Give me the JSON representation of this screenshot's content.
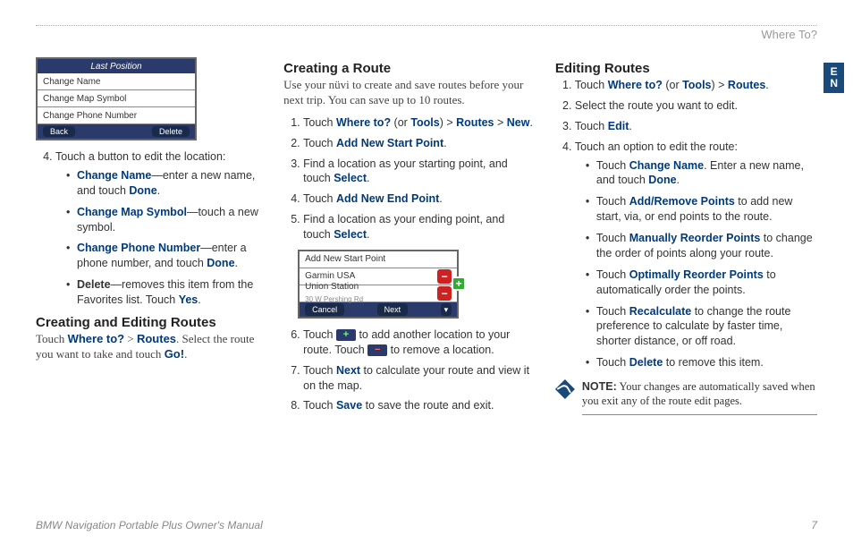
{
  "breadcrumb": "Where To?",
  "side_tab": [
    "E",
    "N"
  ],
  "footer": {
    "left": "BMW Navigation Portable Plus Owner's Manual",
    "page": "7"
  },
  "col1": {
    "device": {
      "title": "Last Position",
      "rows": [
        "Change Name",
        "Change Map Symbol",
        "Change Phone Number"
      ],
      "back": "Back",
      "delete": "Delete"
    },
    "ol_start": 4,
    "step4": "Touch a button to edit the location:",
    "bullets": [
      {
        "b": "Change Name",
        "t": "—enter a new name, and touch ",
        "b2": "Done",
        "t2": "."
      },
      {
        "b": "Change Map Symbol",
        "t": "—touch a new symbol."
      },
      {
        "b": "Change Phone Number",
        "t": "—enter a phone number, and touch ",
        "b2": "Done",
        "t2": "."
      },
      {
        "b_black": "Delete",
        "t": "—removes this item from the Favorites list. Touch ",
        "b2": "Yes",
        "t2": "."
      }
    ],
    "h2": "Creating and Editing Routes",
    "intro_pre": "Touch ",
    "intro_b1": "Where to?",
    "intro_mid": " > ",
    "intro_b2": "Routes",
    "intro_post": ". Select the route you want to take and touch ",
    "intro_b3": "Go!",
    "intro_end": "."
  },
  "col2": {
    "h2": "Creating a Route",
    "intro": "Use your nüvi to create and save routes before your next trip. You can save up to 10 routes.",
    "steps": {
      "s1_pre": "Touch ",
      "s1_b1": "Where to?",
      "s1_mid1": " (or ",
      "s1_b2": "Tools",
      "s1_mid2": ") > ",
      "s1_b3": "Routes",
      "s1_mid3": " > ",
      "s1_b4": "New",
      "s1_end": ".",
      "s2_pre": "Touch ",
      "s2_b": "Add New Start Point",
      "s2_end": ".",
      "s3_pre": "Find a location as your starting point, and touch ",
      "s3_b": "Select",
      "s3_end": ".",
      "s4_pre": "Touch ",
      "s4_b": "Add New End Point",
      "s4_end": ".",
      "s5_pre": "Find a location as your ending point, and touch ",
      "s5_b": "Select",
      "s5_end": ".",
      "s6_pre": "Touch ",
      "s6_mid": " to add another location to your route. Touch ",
      "s6_end": " to remove a location.",
      "s7_pre": "Touch ",
      "s7_b": "Next",
      "s7_end": " to calculate your route and view it on the map.",
      "s8_pre": "Touch ",
      "s8_b": "Save",
      "s8_end": " to save the route and exit."
    },
    "device": {
      "rows": [
        {
          "label": "Add New Start Point"
        },
        {
          "label": "Garmin USA",
          "btn": "red"
        },
        {
          "label": "Union Station",
          "sub": "30 W Pershing Rd",
          "btn": "red"
        }
      ],
      "cancel": "Cancel",
      "next": "Next"
    }
  },
  "col3": {
    "h2": "Editing Routes",
    "s1_pre": "Touch ",
    "s1_b1": "Where to?",
    "s1_mid1": " (or ",
    "s1_b2": "Tools",
    "s1_mid2": ") > ",
    "s1_b3": "Routes",
    "s1_end": ".",
    "s2": "Select the route you want to edit.",
    "s3_pre": "Touch ",
    "s3_b": "Edit",
    "s3_end": ".",
    "s4": "Touch an option to edit the route:",
    "bullets": {
      "b1_pre": "Touch ",
      "b1_b": "Change Name",
      "b1_mid": ". Enter a new name, and touch ",
      "b1_b2": "Done",
      "b1_end": ".",
      "b2_pre": "Touch ",
      "b2_b": "Add/Remove Points",
      "b2_end": " to add new start, via, or end points to the route.",
      "b3_pre": "Touch ",
      "b3_b": "Manually Reorder Points",
      "b3_end": " to change the order of points along your route.",
      "b4_pre": "Touch ",
      "b4_b": "Optimally Reorder Points",
      "b4_end": " to automatically order the points.",
      "b5_pre": "Touch ",
      "b5_b": "Recalculate",
      "b5_end": " to change the route preference to calculate by faster time, shorter distance, or off road.",
      "b6_pre": "Touch ",
      "b6_b": "Delete",
      "b6_end": " to remove this item."
    },
    "note_label": "NOTE:",
    "note": " Your changes are automatically saved when you exit any of the route edit pages."
  }
}
